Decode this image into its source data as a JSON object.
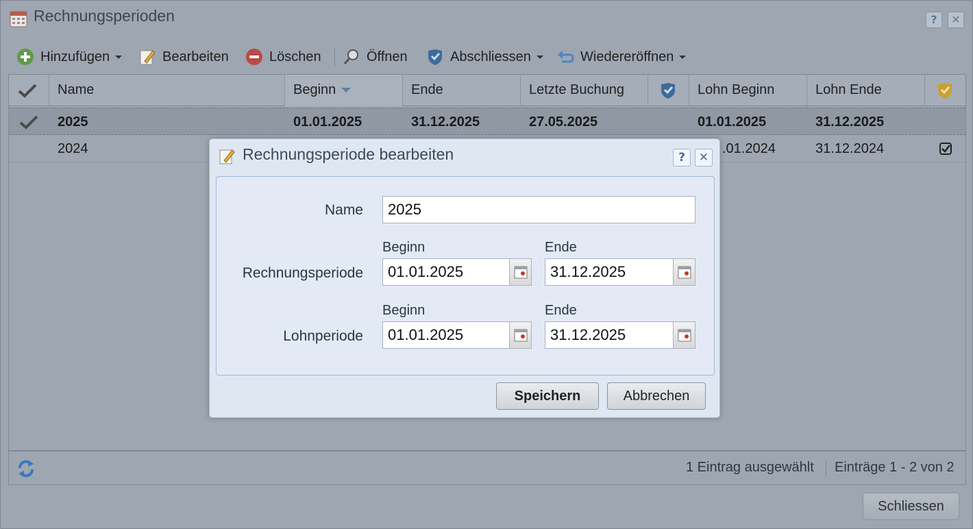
{
  "window": {
    "title": "Rechnungsperioden",
    "help_label": "?",
    "close_label": "✕"
  },
  "toolbar": {
    "add_label": "Hinzufügen",
    "edit_label": "Bearbeiten",
    "delete_label": "Löschen",
    "open_label": "Öffnen",
    "close_period_label": "Abschliessen",
    "reopen_label": "Wiedereröffnen"
  },
  "grid": {
    "columns": {
      "name": "Name",
      "begin": "Beginn",
      "end": "Ende",
      "last_booking": "Letzte Buchung",
      "payroll_begin": "Lohn Beginn",
      "payroll_end": "Lohn Ende"
    },
    "rows": [
      {
        "name": "2025",
        "begin": "01.01.2025",
        "end": "31.12.2025",
        "last_booking": "27.05.2025",
        "payroll_begin": "01.01.2025",
        "payroll_end": "31.12.2025",
        "checked": false
      },
      {
        "name": "2024",
        "begin": "",
        "end": "",
        "last_booking": "",
        "payroll_begin": ".01.2024",
        "payroll_end": "31.12.2024",
        "checked": true
      }
    ]
  },
  "status": {
    "selected_text": "1 Eintrag ausgewählt",
    "range_text": "Einträge 1 - 2 von 2"
  },
  "footer": {
    "close_label": "Schliessen"
  },
  "dialog": {
    "title": "Rechnungsperiode bearbeiten",
    "help_label": "?",
    "close_label": "✕",
    "name_label": "Name",
    "name_value": "2025",
    "begin_label": "Beginn",
    "end_label": "Ende",
    "billing_period_label": "Rechnungsperiode",
    "billing_begin_value": "01.01.2025",
    "billing_end_value": "31.12.2025",
    "payroll_begin_label": "Beginn",
    "payroll_end_label": "Ende",
    "payroll_period_label": "Lohnperiode",
    "payroll_begin_value": "01.01.2025",
    "payroll_end_value": "31.12.2025",
    "save_label": "Speichern",
    "cancel_label": "Abbrechen"
  }
}
